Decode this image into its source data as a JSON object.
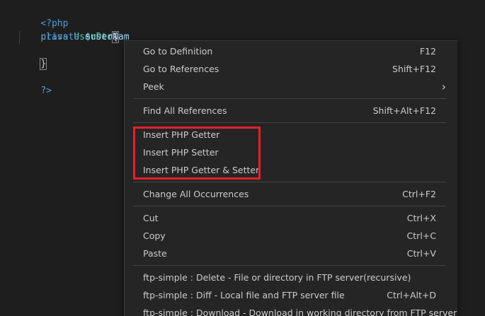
{
  "code": {
    "line0": "",
    "php_open": "<?php",
    "class_kw": "class",
    "class_name": "UserDto",
    "open_brace": "{",
    "private_kw": "private",
    "var_name": "$userNam",
    "close_brace": "}",
    "php_close": "?>"
  },
  "menu": {
    "items": [
      {
        "label": "Go to Definition",
        "shortcut": "F12"
      },
      {
        "label": "Go to References",
        "shortcut": "Shift+F12"
      },
      {
        "label": "Peek",
        "shortcut": ""
      },
      {
        "label": "Find All References",
        "shortcut": "Shift+Alt+F12"
      },
      {
        "label": "Insert PHP Getter",
        "shortcut": ""
      },
      {
        "label": "Insert PHP Setter",
        "shortcut": ""
      },
      {
        "label": "Insert PHP Getter & Setter",
        "shortcut": ""
      },
      {
        "label": "Change All Occurrences",
        "shortcut": "Ctrl+F2"
      },
      {
        "label": "Cut",
        "shortcut": "Ctrl+X"
      },
      {
        "label": "Copy",
        "shortcut": "Ctrl+C"
      },
      {
        "label": "Paste",
        "shortcut": "Ctrl+V"
      },
      {
        "label": "ftp-simple : Delete - File or directory in FTP server(recursive)",
        "shortcut": ""
      },
      {
        "label": "ftp-simple : Diff - Local file and FTP server file",
        "shortcut": "Ctrl+Alt+D"
      },
      {
        "label": "ftp-simple : Download - Download in working directory from FTP server",
        "shortcut": ""
      }
    ],
    "peek_chevron": "›"
  },
  "colors": {
    "keyword": "#569cd6",
    "class": "#4ec9b0",
    "variable": "#9cdcfe",
    "highlight": "#e8202a"
  }
}
